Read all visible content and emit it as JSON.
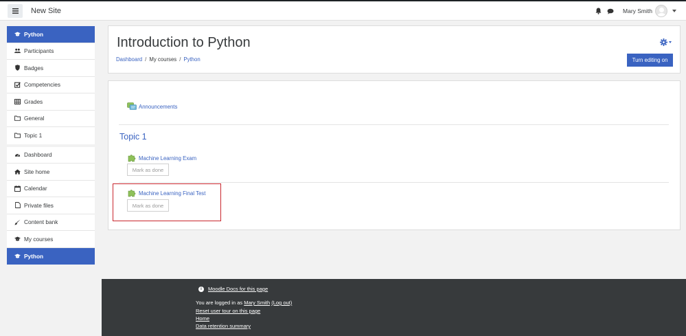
{
  "navbar": {
    "site_name": "New Site",
    "user_name": "Mary Smith"
  },
  "drawer": {
    "course_items": [
      {
        "label": "Python",
        "icon": "graduation-cap-icon",
        "active": true
      },
      {
        "label": "Participants",
        "icon": "users-icon"
      },
      {
        "label": "Badges",
        "icon": "shield-icon"
      },
      {
        "label": "Competencies",
        "icon": "checkbox-icon"
      },
      {
        "label": "Grades",
        "icon": "table-icon"
      },
      {
        "label": "General",
        "icon": "folder-icon"
      },
      {
        "label": "Topic 1",
        "icon": "folder-icon"
      }
    ],
    "site_items": [
      {
        "label": "Dashboard",
        "icon": "dashboard-icon"
      },
      {
        "label": "Site home",
        "icon": "home-icon"
      },
      {
        "label": "Calendar",
        "icon": "calendar-icon"
      },
      {
        "label": "Private files",
        "icon": "file-icon"
      },
      {
        "label": "Content bank",
        "icon": "brush-icon"
      },
      {
        "label": "My courses",
        "icon": "graduation-cap-icon"
      },
      {
        "label": "Python",
        "icon": "graduation-cap-icon",
        "active": true
      }
    ]
  },
  "header": {
    "title": "Introduction to Python",
    "breadcrumb": [
      "Dashboard",
      "My courses",
      "Python"
    ],
    "edit_button": "Turn editing on"
  },
  "course": {
    "announcements": "Announcements",
    "section_title": "Topic 1",
    "activities": [
      {
        "name": "Machine Learning Exam",
        "done_label": "Mark as done"
      },
      {
        "name": "Machine Learning Final Test",
        "done_label": "Mark as done"
      }
    ]
  },
  "footer": {
    "docs_link": "Moodle Docs for this page",
    "logged_in_prefix": "You are logged in as ",
    "logged_in_user": "Mary Smith",
    "logout": "(Log out)",
    "reset_tour": "Reset user tour on this page",
    "home": "Home",
    "data_retention": "Data retention summary"
  },
  "colors": {
    "accent": "#3a63c1",
    "highlight": "#c8252c",
    "footer_bg": "#373a3c"
  }
}
